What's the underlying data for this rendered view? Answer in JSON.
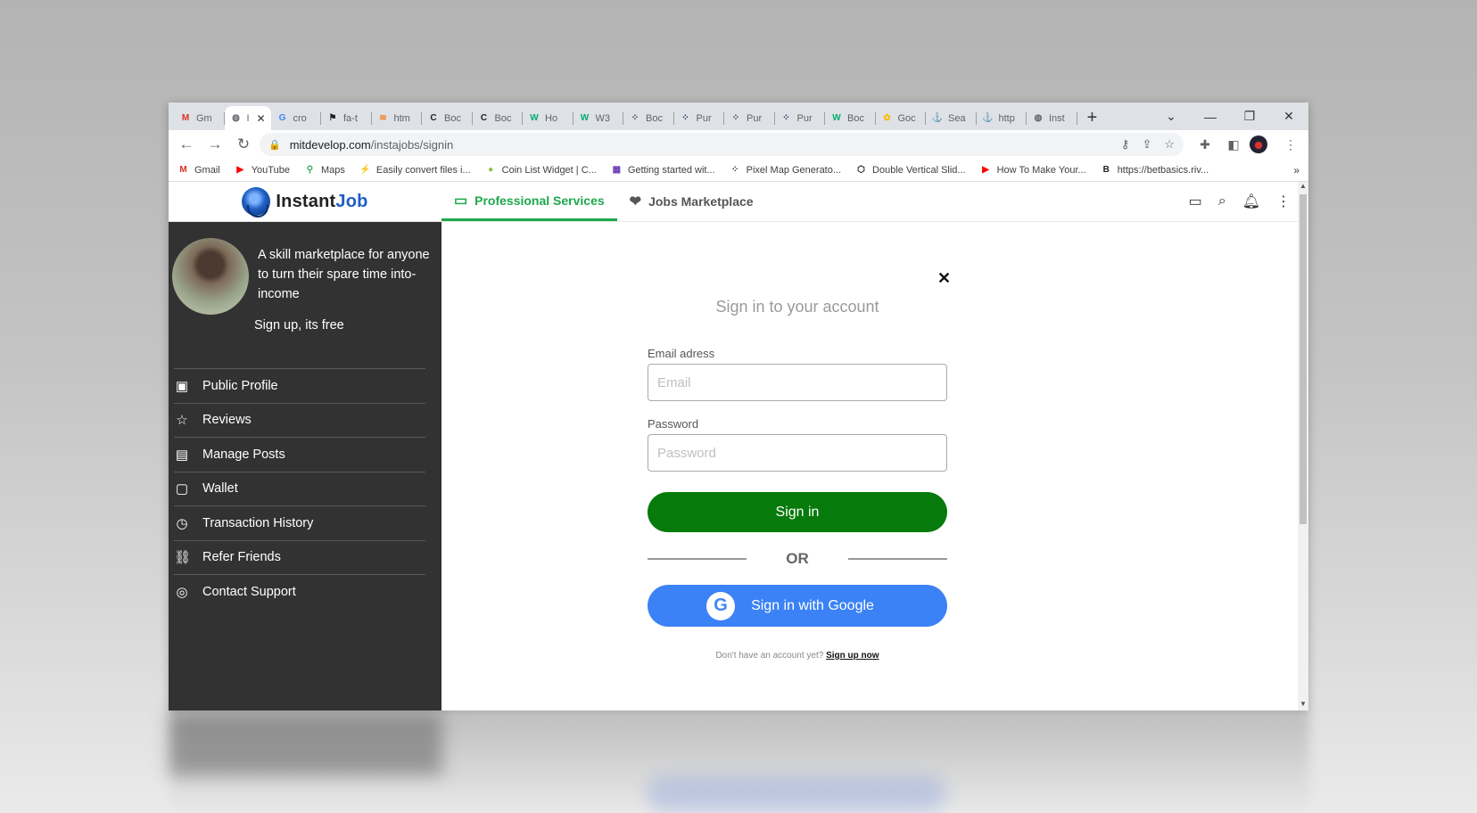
{
  "browser": {
    "tabs": [
      {
        "label": "Gm",
        "icon": "gmail-icon",
        "color": "#d93025",
        "glyph": "M"
      },
      {
        "label": "I",
        "icon": "globe-icon",
        "color": "#5f6368",
        "glyph": "◍",
        "active": true
      },
      {
        "label": "cro",
        "icon": "google-icon",
        "color": "#4285f4",
        "glyph": "G"
      },
      {
        "label": "fa-t",
        "icon": "flag-icon",
        "color": "#222222",
        "glyph": "⚑"
      },
      {
        "label": "htm",
        "icon": "stackoverflow-icon",
        "color": "#f48024",
        "glyph": "≋"
      },
      {
        "label": "Boc",
        "icon": "c-icon",
        "color": "#222222",
        "glyph": "C"
      },
      {
        "label": "Boc",
        "icon": "c-icon",
        "color": "#222222",
        "glyph": "C"
      },
      {
        "label": "Ho",
        "icon": "w3-icon",
        "color": "#04aa6d",
        "glyph": "W"
      },
      {
        "label": "W3",
        "icon": "w3-icon",
        "color": "#04aa6d",
        "glyph": "W"
      },
      {
        "label": "Boc",
        "icon": "dots-icon",
        "color": "#1b2a4e",
        "glyph": "⁘"
      },
      {
        "label": "Pur",
        "icon": "dots-icon",
        "color": "#1b2a4e",
        "glyph": "⁘"
      },
      {
        "label": "Pur",
        "icon": "dots-icon",
        "color": "#1b2a4e",
        "glyph": "⁘"
      },
      {
        "label": "Pur",
        "icon": "dots-icon",
        "color": "#1b2a4e",
        "glyph": "⁘"
      },
      {
        "label": "Boc",
        "icon": "w3-icon",
        "color": "#04aa6d",
        "glyph": "W"
      },
      {
        "label": "Goc",
        "icon": "photos-icon",
        "color": "#fbbc04",
        "glyph": "✿"
      },
      {
        "label": "Sea",
        "icon": "anchor-icon",
        "color": "#222222",
        "glyph": "⚓"
      },
      {
        "label": "http",
        "icon": "anchor-icon",
        "color": "#222222",
        "glyph": "⚓"
      },
      {
        "label": "Inst",
        "icon": "globe-icon",
        "color": "#5f6368",
        "glyph": "◍"
      }
    ],
    "url_host": "mitdevelop.com",
    "url_path": "/instajobs/signin",
    "bookmarks": [
      {
        "label": "Gmail",
        "icon": "gmail-icon",
        "color": "#d93025",
        "glyph": "M"
      },
      {
        "label": "YouTube",
        "icon": "youtube-icon",
        "color": "#ff0000",
        "glyph": "▶"
      },
      {
        "label": "Maps",
        "icon": "maps-icon",
        "color": "#34a853",
        "glyph": "⚲"
      },
      {
        "label": "Easily convert files i...",
        "icon": "bolt-icon",
        "color": "#f5a623",
        "glyph": "⚡"
      },
      {
        "label": "Coin List Widget | C...",
        "icon": "coin-icon",
        "color": "#8bc34a",
        "glyph": "●"
      },
      {
        "label": "Getting started wit...",
        "icon": "grid-icon",
        "color": "#6a3ab7",
        "glyph": "▦"
      },
      {
        "label": "Pixel Map Generato...",
        "icon": "pixel-icon",
        "color": "#333333",
        "glyph": "⁘"
      },
      {
        "label": "Double Vertical Slid...",
        "icon": "codepen-icon",
        "color": "#111111",
        "glyph": "⬡"
      },
      {
        "label": "How To Make Your...",
        "icon": "youtube-icon",
        "color": "#ff0000",
        "glyph": "▶"
      },
      {
        "label": "https://betbasics.riv...",
        "icon": "bet-icon",
        "color": "#222222",
        "glyph": "B"
      }
    ]
  },
  "app": {
    "brand_main": "Instant",
    "brand_accent": "Job",
    "tabs": [
      {
        "label": "Professional Services",
        "icon": "briefcase-icon",
        "glyph": "💼"
      },
      {
        "label": "Jobs Marketplace",
        "icon": "hand-heart-icon",
        "glyph": "🤲"
      }
    ],
    "accent_color": "#1ea84c"
  },
  "sidebar": {
    "tagline": "A skill marketplace for anyone to turn their spare time into-income",
    "signup_text": "Sign up, its free",
    "items": [
      {
        "label": "Public Profile",
        "icon": "profile-icon",
        "glyph": "▣"
      },
      {
        "label": "Reviews",
        "icon": "stars-icon",
        "glyph": "☆"
      },
      {
        "label": "Manage Posts",
        "icon": "posts-icon",
        "glyph": "▤"
      },
      {
        "label": "Wallet",
        "icon": "wallet-icon",
        "glyph": "▢"
      },
      {
        "label": "Transaction History",
        "icon": "history-icon",
        "glyph": "◷"
      },
      {
        "label": "Refer Friends",
        "icon": "link-icon",
        "glyph": "⛓"
      },
      {
        "label": "Contact Support",
        "icon": "lifebuoy-icon",
        "glyph": "◎"
      }
    ]
  },
  "signin": {
    "title": "Sign in to your account",
    "email_label": "Email adress",
    "email_placeholder": "Email",
    "password_label": "Password",
    "password_placeholder": "Password",
    "submit_label": "Sign in",
    "or_text": "OR",
    "google_label": "Sign in with Google",
    "no_account_text": "Don't have an account yet?",
    "signup_link": "Sign up now",
    "primary_color": "#067a0a",
    "google_color": "#3b82f6"
  }
}
